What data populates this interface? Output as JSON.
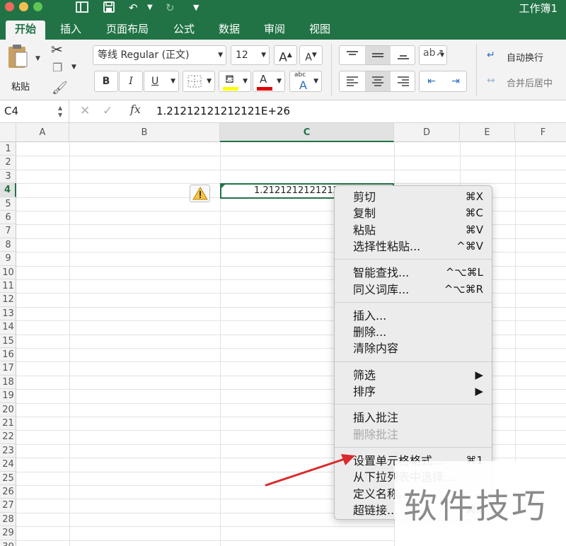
{
  "app": {
    "doc_title": "工作簿1",
    "accent": "#217346"
  },
  "tabs": [
    "开始",
    "插入",
    "页面布局",
    "公式",
    "数据",
    "审阅",
    "视图"
  ],
  "ribbon": {
    "paste_label": "粘贴",
    "font_name": "等线 Regular (正文)",
    "font_size": "12",
    "bold": "B",
    "italic": "I",
    "underline": "U",
    "grow_font": "A",
    "shrink_font": "A",
    "phonetic": "abc",
    "wrap_text": "自动换行",
    "merge_center": "合并后居中"
  },
  "formula_bar": {
    "name_box": "C4",
    "fx": "fx",
    "content": "1.21212121212121E+26"
  },
  "sheet": {
    "columns": [
      "A",
      "B",
      "C",
      "D",
      "E",
      "F"
    ],
    "selected_column": "C",
    "rows": [
      "1",
      "2",
      "3",
      "4",
      "5",
      "6",
      "7",
      "8",
      "9",
      "10",
      "11",
      "12",
      "13",
      "14",
      "15",
      "16",
      "17",
      "18",
      "19",
      "20",
      "21",
      "22",
      "23",
      "24",
      "25",
      "26",
      "27",
      "28",
      "29",
      "30"
    ],
    "selected_row": "4",
    "cell_c4": "1.21212121212121E+26"
  },
  "context_menu": {
    "items": [
      {
        "label": "剪切",
        "shortcut": "⌘X"
      },
      {
        "label": "复制",
        "shortcut": "⌘C"
      },
      {
        "label": "粘贴",
        "shortcut": "⌘V"
      },
      {
        "label": "选择性粘贴...",
        "shortcut": "^⌘V"
      },
      {
        "label": "智能查找...",
        "shortcut": "^⌥⌘L"
      },
      {
        "label": "同义词库...",
        "shortcut": "^⌥⌘R"
      },
      {
        "label": "插入...",
        "shortcut": ""
      },
      {
        "label": "删除...",
        "shortcut": ""
      },
      {
        "label": "清除内容",
        "shortcut": ""
      },
      {
        "label": "筛选",
        "shortcut": "▶"
      },
      {
        "label": "排序",
        "shortcut": "▶"
      },
      {
        "label": "插入批注",
        "shortcut": ""
      },
      {
        "label": "删除批注",
        "shortcut": ""
      },
      {
        "label": "设置单元格格式...",
        "shortcut": "⌘1"
      },
      {
        "label": "从下拉列表中选择...",
        "shortcut": ""
      },
      {
        "label": "定义名称...",
        "shortcut": ""
      },
      {
        "label": "超链接...",
        "shortcut": "⌘K"
      }
    ]
  },
  "watermark": "软件技巧"
}
